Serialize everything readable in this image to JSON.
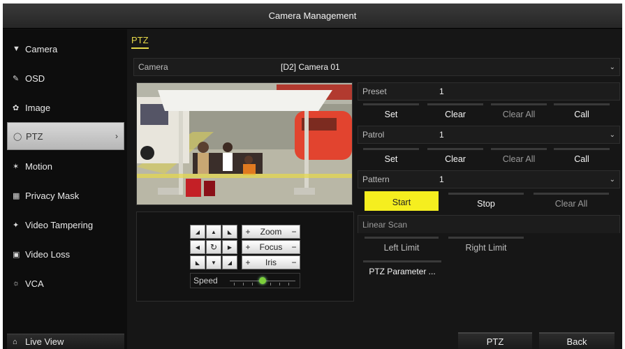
{
  "window": {
    "title": "Camera Management"
  },
  "sidebar": {
    "items": [
      {
        "label": "Camera",
        "icon": "camera-icon"
      },
      {
        "label": "OSD",
        "icon": "osd-icon"
      },
      {
        "label": "Image",
        "icon": "image-icon"
      },
      {
        "label": "PTZ",
        "icon": "ptz-icon",
        "active": true
      },
      {
        "label": "Motion",
        "icon": "motion-icon"
      },
      {
        "label": "Privacy Mask",
        "icon": "privacy-mask-icon"
      },
      {
        "label": "Video Tampering",
        "icon": "video-tampering-icon"
      },
      {
        "label": "Video Loss",
        "icon": "video-loss-icon"
      },
      {
        "label": "VCA",
        "icon": "vca-icon"
      }
    ],
    "live_view": "Live View"
  },
  "main": {
    "tab": "PTZ",
    "camera": {
      "label": "Camera",
      "value": "[D2] Camera 01"
    },
    "preset": {
      "label": "Preset",
      "value": "1",
      "buttons": [
        "Set",
        "Clear",
        "Clear All",
        "Call"
      ]
    },
    "patrol": {
      "label": "Patrol",
      "value": "1",
      "buttons": [
        "Set",
        "Clear",
        "Clear All",
        "Call"
      ]
    },
    "pattern": {
      "label": "Pattern",
      "value": "1",
      "buttons": [
        "Start",
        "Stop",
        "Clear All"
      ]
    },
    "linear_scan": {
      "label": "Linear Scan",
      "buttons": [
        "Left Limit",
        "Right Limit"
      ]
    },
    "ptz_parameter": "PTZ Parameter ...",
    "controls": {
      "zoom": "Zoom",
      "focus": "Focus",
      "iris": "Iris",
      "plus": "+",
      "minus": "−",
      "speed": "Speed"
    }
  },
  "footer": {
    "ptz": "PTZ",
    "back": "Back"
  },
  "colors": {
    "accent": "#e6d94a",
    "highlight_button": "#f5ee1f",
    "background": "#141414"
  }
}
